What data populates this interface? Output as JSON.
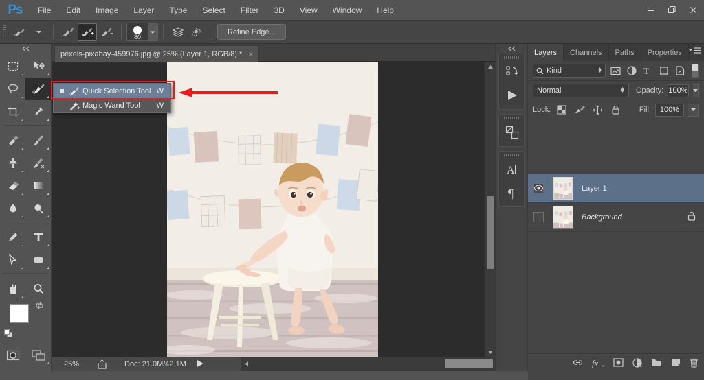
{
  "app": {
    "logo": "Ps"
  },
  "menubar": {
    "items": [
      "File",
      "Edit",
      "Image",
      "Layer",
      "Type",
      "Select",
      "Filter",
      "3D",
      "View",
      "Window",
      "Help"
    ]
  },
  "window_controls": {
    "minimize": "minimize-icon",
    "restore": "restore-icon",
    "close": "close-icon"
  },
  "options_bar": {
    "tool_preset_icon": "quick-selection-preset-icon",
    "mode_new_icon": "selection-new-icon",
    "mode_add_icon": "selection-add-icon",
    "mode_subtract_icon": "selection-subtract-icon",
    "brush_size": "80",
    "sample_all_layers_icon": "sample-all-layers-icon",
    "auto_enhance_icon": "auto-enhance-icon",
    "refine_edge_label": "Refine Edge..."
  },
  "toolbar": {
    "collapse_label": "«",
    "tools": [
      {
        "name": "rectangular-marquee-tool"
      },
      {
        "name": "move-tool"
      },
      {
        "name": "lasso-tool"
      },
      {
        "name": "quick-selection-tool",
        "active": true
      },
      {
        "name": "crop-tool"
      },
      {
        "name": "eyedropper-tool"
      },
      {
        "name": "spot-healing-brush-tool"
      },
      {
        "name": "brush-tool"
      },
      {
        "name": "clone-stamp-tool"
      },
      {
        "name": "history-brush-tool"
      },
      {
        "name": "eraser-tool"
      },
      {
        "name": "gradient-tool"
      },
      {
        "name": "blur-tool"
      },
      {
        "name": "dodge-tool"
      },
      {
        "name": "pen-tool"
      },
      {
        "name": "horizontal-type-tool"
      },
      {
        "name": "path-selection-tool"
      },
      {
        "name": "rectangle-tool"
      },
      {
        "name": "hand-tool"
      },
      {
        "name": "zoom-tool"
      }
    ],
    "foreground_color": "#ffffff",
    "background_color": "#ffffff",
    "quick_mask_icon": "quick-mask-icon",
    "screen_mode_icon": "screen-mode-icon"
  },
  "tool_flyout": {
    "items": [
      {
        "label": "Quick Selection Tool",
        "shortcut": "W",
        "selected": true,
        "icon": "quick-selection-tool-icon"
      },
      {
        "label": "Magic Wand Tool",
        "shortcut": "W",
        "selected": false,
        "icon": "magic-wand-tool-icon"
      }
    ],
    "highlight_color": "#e81c1c",
    "annotation_arrow_color": "#e81c1c"
  },
  "document": {
    "tab_title": "pexels-pixabay-459976.jpg @ 25% (Layer 1, RGB/8) *",
    "tab_close": "×"
  },
  "status_bar": {
    "zoom": "25%",
    "share_icon": "share-icon",
    "doc_info": "Doc: 21.0M/42.1M",
    "play_icon": "play-icon"
  },
  "icon_dock": {
    "collapse_label": "«",
    "groups": [
      {
        "items": [
          {
            "name": "history-icon"
          },
          {
            "name": "actions-play-icon"
          }
        ]
      },
      {
        "items": [
          {
            "name": "adjustments-icon"
          }
        ]
      },
      {
        "items": [
          {
            "name": "character-icon",
            "glyph": "A"
          },
          {
            "name": "paragraph-icon",
            "glyph": "¶"
          }
        ]
      }
    ]
  },
  "layers_panel": {
    "tabs": [
      {
        "label": "Layers",
        "active": true
      },
      {
        "label": "Channels",
        "active": false
      },
      {
        "label": "Paths",
        "active": false
      },
      {
        "label": "Properties",
        "active": false
      }
    ],
    "panel_menu_icon": "panel-menu-icon",
    "filter": {
      "search_icon": "search-icon",
      "kind_label": "Kind",
      "icons": [
        "filter-pixel-icon",
        "filter-adjustment-icon",
        "filter-type-icon",
        "filter-shape-icon",
        "filter-smart-object-icon"
      ],
      "toggle_icon": "filter-toggle-icon"
    },
    "blend_mode": "Normal",
    "opacity_label": "Opacity:",
    "opacity_value": "100%",
    "lock_label": "Lock:",
    "lock_icons": [
      "lock-transparent-pixels-icon",
      "lock-image-pixels-icon",
      "lock-position-icon",
      "lock-all-icon"
    ],
    "fill_label": "Fill:",
    "fill_value": "100%",
    "layers": [
      {
        "name": "Layer 1",
        "visible": true,
        "selected": true,
        "locked": false,
        "italic": false
      },
      {
        "name": "Background",
        "visible": false,
        "selected": false,
        "locked": true,
        "italic": true
      }
    ],
    "selected_row_color": "#5c708a",
    "footer_buttons": [
      {
        "name": "link-layers-button",
        "glyph": "link-icon"
      },
      {
        "name": "layer-style-button",
        "glyph": "fx-icon"
      },
      {
        "name": "add-layer-mask-button",
        "glyph": "mask-icon"
      },
      {
        "name": "new-adjustment-layer-button",
        "glyph": "adjustment-icon"
      },
      {
        "name": "new-group-button",
        "glyph": "folder-icon"
      },
      {
        "name": "new-layer-button",
        "glyph": "new-layer-icon"
      },
      {
        "name": "delete-layer-button",
        "glyph": "trash-icon"
      }
    ]
  },
  "canvas": {
    "image_description": "baby standing at a cream wooden stool with fabric bunting on a cream wall"
  }
}
